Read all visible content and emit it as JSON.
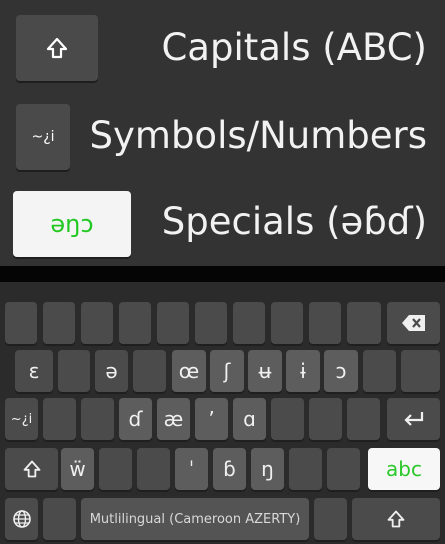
{
  "legend": {
    "capitals": {
      "key_icon": "shift-icon",
      "label": "Capitals (ABC)"
    },
    "symbols": {
      "key_label": "~¿i",
      "label": "Symbols/Numbers"
    },
    "specials": {
      "key_label": "əŋɔ",
      "label": "Specials (əɓɗ)"
    }
  },
  "keyboard": {
    "row1": {
      "keys": [
        "",
        "",
        "",
        "",
        "",
        "",
        "",
        "",
        "",
        "",
        ""
      ],
      "backspace_icon": "backspace-icon"
    },
    "row2": {
      "keys": [
        "ɛ",
        "",
        "ə",
        "",
        "œ",
        "ʃ",
        "ʉ",
        "ɨ",
        "ɔ",
        "",
        ""
      ]
    },
    "row3": {
      "sym_label": "~¿i",
      "keys": [
        "",
        "",
        "ɗ",
        "æ",
        "’",
        "ɑ",
        "",
        ""
      ],
      "enter_icon": "enter-icon"
    },
    "row4": {
      "shift_icon": "shift-icon",
      "keys": [
        "ẅ",
        "",
        "",
        "ˈ",
        "ɓ",
        "ŋ",
        ""
      ],
      "abc_label": "abc"
    },
    "row5": {
      "globe_icon": "globe-icon",
      "space_label": "Mutlilingual (Cameroon AZERTY)",
      "shift_icon": "shift-icon"
    }
  },
  "colors": {
    "accent": "#22c822",
    "key": "#4b4b4b",
    "background": "#2b2b2b"
  }
}
